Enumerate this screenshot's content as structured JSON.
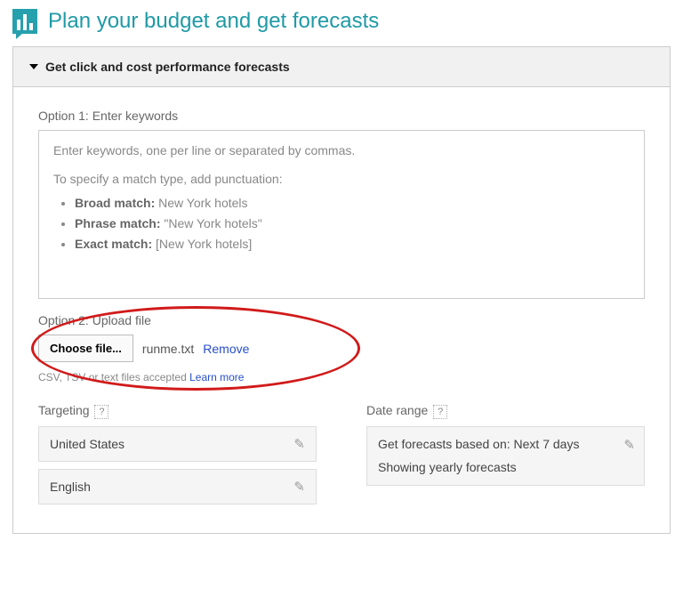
{
  "header": {
    "title": "Plan your budget and get forecasts"
  },
  "panel": {
    "title": "Get click and cost performance forecasts"
  },
  "option1": {
    "label": "Option 1: Enter keywords",
    "placeholder_line1": "Enter keywords, one per line or separated by commas.",
    "placeholder_line2": "To specify a match type, add punctuation:",
    "matches": [
      {
        "label": "Broad match:",
        "example": "New York hotels"
      },
      {
        "label": "Phrase match:",
        "example": "\"New York hotels\""
      },
      {
        "label": "Exact match:",
        "example": "[New York hotels]"
      }
    ]
  },
  "option2": {
    "label": "Option 2: Upload file",
    "choose_btn": "Choose file...",
    "filename": "runme.txt",
    "remove": "Remove",
    "accepted": "CSV, TSV or text files accepted",
    "learn_more": "Learn more"
  },
  "targeting": {
    "label": "Targeting",
    "location": "United States",
    "language": "English"
  },
  "date_range": {
    "label": "Date range",
    "forecast_basis_prefix": "Get forecasts based on: ",
    "forecast_basis_value": "Next 7 days",
    "yearly": "Showing yearly forecasts"
  },
  "help_glyph": "?"
}
